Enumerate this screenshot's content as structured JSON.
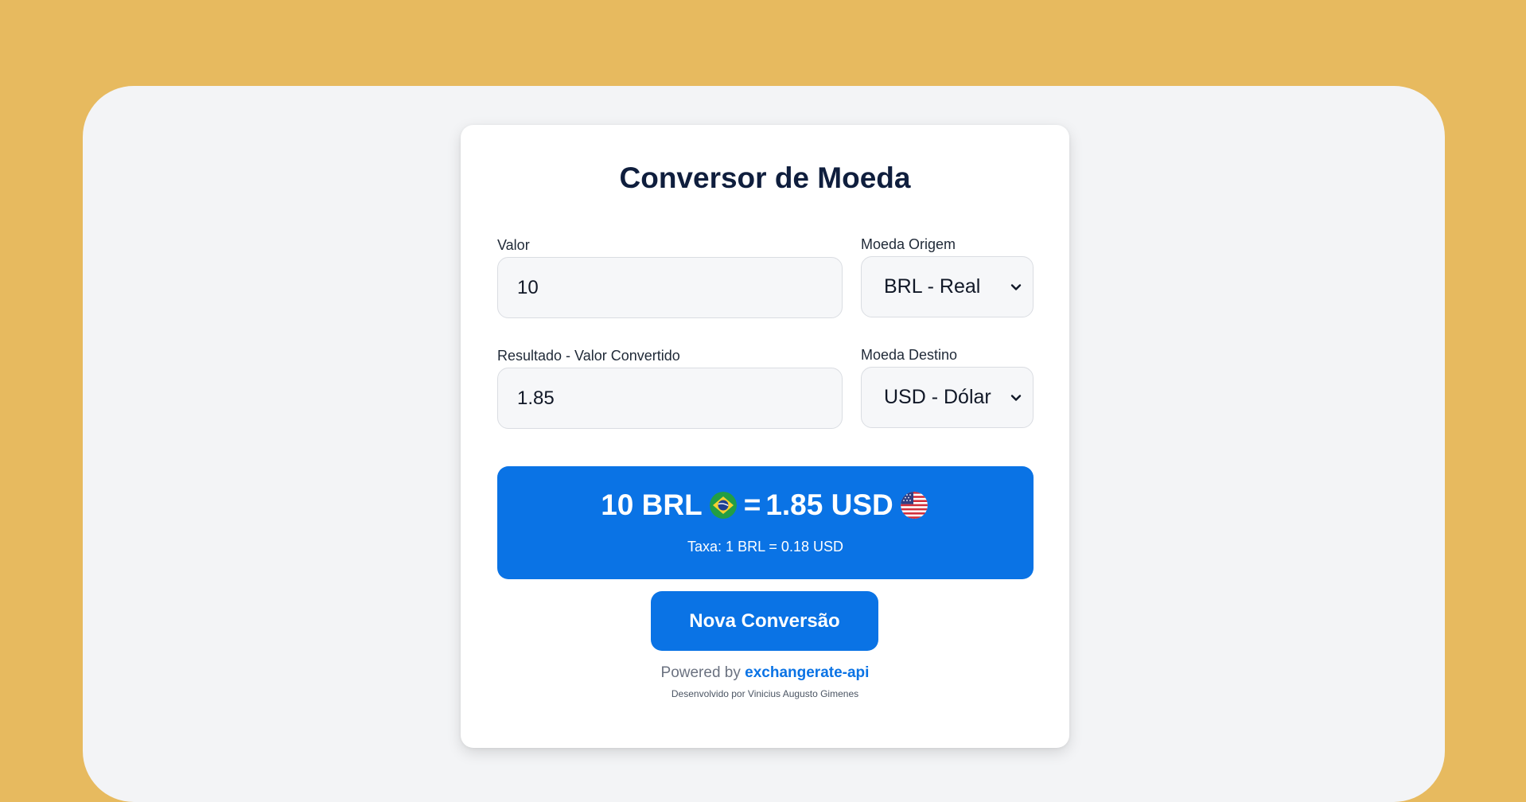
{
  "app": {
    "title": "Conversor de Moeda"
  },
  "form": {
    "amount_label": "Valor",
    "amount_value": "10",
    "from_label": "Moeda Origem",
    "from_selected": "BRL - Real",
    "result_label": "Resultado - Valor Convertido",
    "result_value": "1.85",
    "to_label": "Moeda Destino",
    "to_selected": "USD - Dólar"
  },
  "result": {
    "amount_text": "10 BRL",
    "equals": "=",
    "converted_text": "1.85 USD",
    "from_flag_icon": "brazil-flag-icon",
    "to_flag_icon": "usa-flag-icon",
    "rate_text": "Taxa: 1 BRL = 0.18 USD"
  },
  "actions": {
    "new_conversion_label": "Nova Conversão"
  },
  "footer": {
    "powered_prefix": "Powered by",
    "powered_link": "exchangerate-api",
    "developer_text": "Desenvolvido por Vinicius Augusto Gimenes"
  },
  "colors": {
    "background": "#E7BA5F",
    "window": "#F3F4F6",
    "accent": "#0A73E5",
    "title": "#0F1E3D"
  }
}
